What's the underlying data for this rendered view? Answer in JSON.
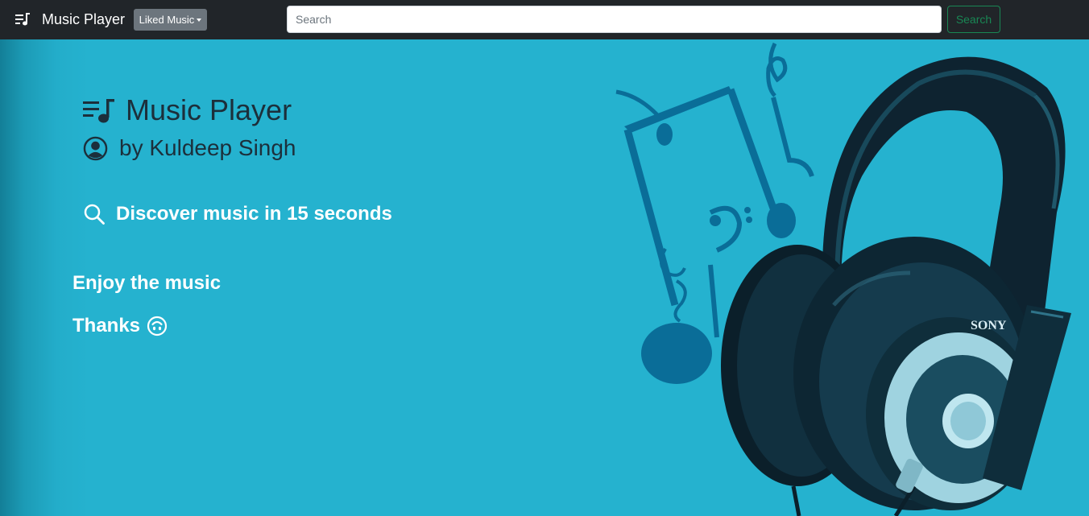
{
  "navbar": {
    "brand_icon": "playlist-music-icon",
    "brand_text": "Music Player",
    "dropdown_label": "Liked Music",
    "search_placeholder": "Search",
    "search_button_label": "Search"
  },
  "hero": {
    "title_icon": "playlist-music-icon",
    "title": "Music Player",
    "author_icon": "person-circle-icon",
    "author": "by Kuldeep Singh",
    "discover_icon": "search-icon",
    "discover": "Discover music in 15 seconds",
    "enjoy": "Enjoy the music",
    "thanks": "Thanks",
    "thanks_icon": "upside-down-smile-icon",
    "image_brand": "SONY"
  },
  "colors": {
    "navbar_bg": "#212529",
    "hero_bg": "#25b2cf",
    "title_text": "#1c2f3b",
    "success": "#198754",
    "secondary": "#6c757d"
  }
}
